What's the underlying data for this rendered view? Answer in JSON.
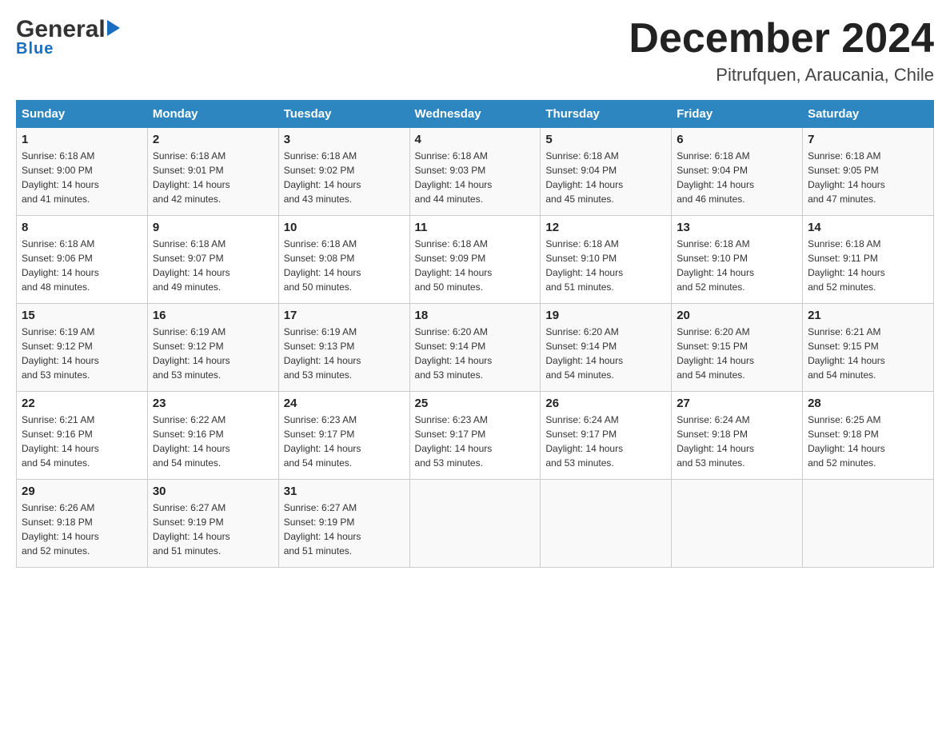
{
  "header": {
    "logo_general": "General",
    "logo_blue": "Blue",
    "month_title": "December 2024",
    "location": "Pitrufquen, Araucania, Chile"
  },
  "days_of_week": [
    "Sunday",
    "Monday",
    "Tuesday",
    "Wednesday",
    "Thursday",
    "Friday",
    "Saturday"
  ],
  "weeks": [
    [
      {
        "day": "1",
        "sunrise": "6:18 AM",
        "sunset": "9:00 PM",
        "daylight": "14 hours and 41 minutes."
      },
      {
        "day": "2",
        "sunrise": "6:18 AM",
        "sunset": "9:01 PM",
        "daylight": "14 hours and 42 minutes."
      },
      {
        "day": "3",
        "sunrise": "6:18 AM",
        "sunset": "9:02 PM",
        "daylight": "14 hours and 43 minutes."
      },
      {
        "day": "4",
        "sunrise": "6:18 AM",
        "sunset": "9:03 PM",
        "daylight": "14 hours and 44 minutes."
      },
      {
        "day": "5",
        "sunrise": "6:18 AM",
        "sunset": "9:04 PM",
        "daylight": "14 hours and 45 minutes."
      },
      {
        "day": "6",
        "sunrise": "6:18 AM",
        "sunset": "9:04 PM",
        "daylight": "14 hours and 46 minutes."
      },
      {
        "day": "7",
        "sunrise": "6:18 AM",
        "sunset": "9:05 PM",
        "daylight": "14 hours and 47 minutes."
      }
    ],
    [
      {
        "day": "8",
        "sunrise": "6:18 AM",
        "sunset": "9:06 PM",
        "daylight": "14 hours and 48 minutes."
      },
      {
        "day": "9",
        "sunrise": "6:18 AM",
        "sunset": "9:07 PM",
        "daylight": "14 hours and 49 minutes."
      },
      {
        "day": "10",
        "sunrise": "6:18 AM",
        "sunset": "9:08 PM",
        "daylight": "14 hours and 50 minutes."
      },
      {
        "day": "11",
        "sunrise": "6:18 AM",
        "sunset": "9:09 PM",
        "daylight": "14 hours and 50 minutes."
      },
      {
        "day": "12",
        "sunrise": "6:18 AM",
        "sunset": "9:10 PM",
        "daylight": "14 hours and 51 minutes."
      },
      {
        "day": "13",
        "sunrise": "6:18 AM",
        "sunset": "9:10 PM",
        "daylight": "14 hours and 52 minutes."
      },
      {
        "day": "14",
        "sunrise": "6:18 AM",
        "sunset": "9:11 PM",
        "daylight": "14 hours and 52 minutes."
      }
    ],
    [
      {
        "day": "15",
        "sunrise": "6:19 AM",
        "sunset": "9:12 PM",
        "daylight": "14 hours and 53 minutes."
      },
      {
        "day": "16",
        "sunrise": "6:19 AM",
        "sunset": "9:12 PM",
        "daylight": "14 hours and 53 minutes."
      },
      {
        "day": "17",
        "sunrise": "6:19 AM",
        "sunset": "9:13 PM",
        "daylight": "14 hours and 53 minutes."
      },
      {
        "day": "18",
        "sunrise": "6:20 AM",
        "sunset": "9:14 PM",
        "daylight": "14 hours and 53 minutes."
      },
      {
        "day": "19",
        "sunrise": "6:20 AM",
        "sunset": "9:14 PM",
        "daylight": "14 hours and 54 minutes."
      },
      {
        "day": "20",
        "sunrise": "6:20 AM",
        "sunset": "9:15 PM",
        "daylight": "14 hours and 54 minutes."
      },
      {
        "day": "21",
        "sunrise": "6:21 AM",
        "sunset": "9:15 PM",
        "daylight": "14 hours and 54 minutes."
      }
    ],
    [
      {
        "day": "22",
        "sunrise": "6:21 AM",
        "sunset": "9:16 PM",
        "daylight": "14 hours and 54 minutes."
      },
      {
        "day": "23",
        "sunrise": "6:22 AM",
        "sunset": "9:16 PM",
        "daylight": "14 hours and 54 minutes."
      },
      {
        "day": "24",
        "sunrise": "6:23 AM",
        "sunset": "9:17 PM",
        "daylight": "14 hours and 54 minutes."
      },
      {
        "day": "25",
        "sunrise": "6:23 AM",
        "sunset": "9:17 PM",
        "daylight": "14 hours and 53 minutes."
      },
      {
        "day": "26",
        "sunrise": "6:24 AM",
        "sunset": "9:17 PM",
        "daylight": "14 hours and 53 minutes."
      },
      {
        "day": "27",
        "sunrise": "6:24 AM",
        "sunset": "9:18 PM",
        "daylight": "14 hours and 53 minutes."
      },
      {
        "day": "28",
        "sunrise": "6:25 AM",
        "sunset": "9:18 PM",
        "daylight": "14 hours and 52 minutes."
      }
    ],
    [
      {
        "day": "29",
        "sunrise": "6:26 AM",
        "sunset": "9:18 PM",
        "daylight": "14 hours and 52 minutes."
      },
      {
        "day": "30",
        "sunrise": "6:27 AM",
        "sunset": "9:19 PM",
        "daylight": "14 hours and 51 minutes."
      },
      {
        "day": "31",
        "sunrise": "6:27 AM",
        "sunset": "9:19 PM",
        "daylight": "14 hours and 51 minutes."
      },
      null,
      null,
      null,
      null
    ]
  ],
  "labels": {
    "sunrise": "Sunrise:",
    "sunset": "Sunset:",
    "daylight": "Daylight:"
  }
}
